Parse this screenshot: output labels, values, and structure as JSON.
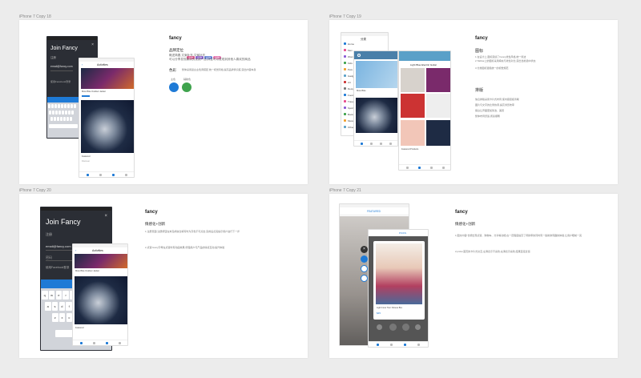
{
  "frames": [
    {
      "label": "iPhone 7 Copy 18"
    },
    {
      "label": "iPhone 7 Copy 19"
    },
    {
      "label": "iPhone 7 Copy 20"
    },
    {
      "label": "iPhone 7 Copy 21"
    }
  ],
  "f1": {
    "title": "fancy",
    "brand_heading": "品牌定位",
    "brand_tags": [
      "品牌",
      "品牌",
      "品牌",
      "品牌"
    ],
    "brand_text_1": "概述简要,文案补充,文案补充",
    "brand_text_2": "可以分享发现喜欢的优质产品,并且可以发现到其他人喜欢的商品",
    "color_heading": "色彩",
    "color_text": "整体采用蓝白主色调搭配,统一视觉风格,提高品牌辨识度,突出内容本身",
    "color_labels": [
      "主色",
      "辅助色"
    ],
    "colors": [
      "#1e7ad6",
      "#3fa34d"
    ],
    "login_title": "Join Fancy",
    "login_subtitle": "注册",
    "login_email": "email@fancy.com",
    "login_fb": "使用Facebook登录",
    "screen_title": "Activities",
    "caption": "Moto Bike Outdoor Jacket",
    "caption_2": "Featured",
    "row_text": "Discover",
    "keys": [
      "q",
      "w",
      "e",
      "r",
      "t",
      "y",
      "u",
      "i",
      "o",
      "p"
    ]
  },
  "f2": {
    "title": "fancy",
    "heading_1": "图标",
    "text_1": "1.在设计上,图标延续了Fancy线性风格,统一简洁",
    "text_2": "2.Tabbar上的图标采用填充与线性对比,突出当前选中状态",
    "text_3": "3.分类图标遵循统一的视觉规范",
    "heading_2": "排版",
    "text_4": "信息排版采用卡片式布局,使内容层级清晰",
    "text_5": "图片与文字的比例协调,提高浏览效率",
    "text_6": "留白让界面更加简洁、美观",
    "text_7": "整体布局舒适,阅读顺畅",
    "menu_title": "分类",
    "menu_items": [
      "Home",
      "Men",
      "Women",
      "Kids",
      "Pets",
      "Gadgets",
      "Art",
      "Design",
      "Food",
      "Travel",
      "Sports",
      "Books",
      "Music",
      "Other"
    ],
    "grid_title": "Light Blue Electric Guitar",
    "grid_caption": "Featured Products",
    "list_caption": "Moto Bike"
  },
  "f3": {
    "title": "fancy",
    "heading": "情感化+创新",
    "point_1": "1.注册页面:注册按钮在未完成信息填写时为灰色不可点击,完成后点亮提示用户进行下一步",
    "point_2": "2.点赞:fancy字母在点赞时有动画效果,增强用户与产品的情感互动,提升体验",
    "login_title": "Join Fancy",
    "login_subtitle": "注册",
    "login_email": "email@fancy.com",
    "login_pwd": "密码",
    "login_fb": "使用Facebook登录",
    "login_btn": "登录",
    "screen_title": "Activities",
    "caption": "Moto Bike Outdoor Jacket",
    "caption_2": "Featured",
    "keys_row1": [
      "q",
      "w",
      "e",
      "r",
      "t",
      "y",
      "u",
      "i",
      "o",
      "p"
    ],
    "keys_row2": [
      "a",
      "s",
      "d",
      "f",
      "g",
      "h",
      "j",
      "k",
      "l"
    ],
    "keys_row3": [
      "z",
      "x",
      "c",
      "v",
      "b",
      "n",
      "m"
    ]
  },
  "f4": {
    "title": "fancy",
    "heading": "情感化+创新",
    "point_1": "1.图文内容:长按出现点赞、购物车、分享等功能,在一定程度提高了转换率的同时有一些新鲜有趣的体验,让用户眼前一亮",
    "point_2": "2.picks:首页的卡片式交互,左滑表示不喜欢,右滑表示喜欢,结果直接反馈",
    "tab_featured": "FEATURED",
    "tab_picks": "PICKS",
    "caption": "Light Inner Tour Fitness Bra",
    "price": "$45",
    "nav_items": [
      "最新",
      "热门",
      "推荐"
    ]
  }
}
